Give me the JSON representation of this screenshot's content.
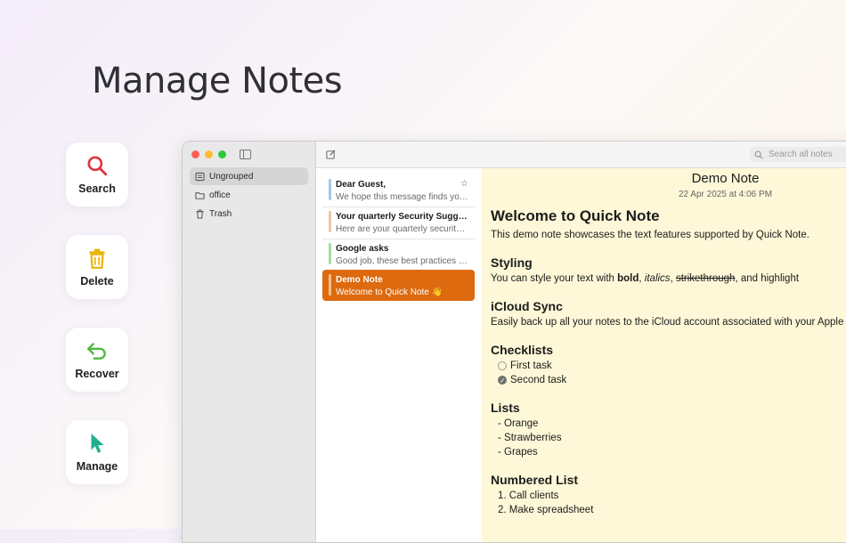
{
  "headline": "Manage Notes",
  "features": [
    {
      "label": "Search",
      "icon": "search-icon",
      "color": "#e0343a"
    },
    {
      "label": "Delete",
      "icon": "trash-icon",
      "color": "#e8b400"
    },
    {
      "label": "Recover",
      "icon": "undo-arrow-icon",
      "color": "#4fb83a"
    },
    {
      "label": "Manage",
      "icon": "pointer-icon",
      "color": "#1fb08e"
    }
  ],
  "sidebar": {
    "items": [
      {
        "label": "Ungrouped",
        "icon": "notes-list-icon",
        "selected": true
      },
      {
        "label": "office",
        "icon": "folder-icon"
      },
      {
        "label": "Trash",
        "icon": "trash-icon"
      }
    ]
  },
  "toolbar": {
    "search_placeholder": "Search all notes"
  },
  "notes": [
    {
      "title": "Dear Guest,",
      "preview": "We hope this message finds you well.",
      "color": "#a8c6e6",
      "starred": true
    },
    {
      "title": "Your quarterly Security Suggestions",
      "preview": "Here are your quarterly security tips",
      "color": "#e9c9a4"
    },
    {
      "title": "Google asks",
      "preview": "Good job, these best practices help",
      "color": "#a6dca0"
    },
    {
      "title": "Demo Note",
      "preview": "Welcome to Quick Note 👋",
      "color": "#f6c08a",
      "selected": true
    }
  ],
  "editor": {
    "title": "Demo Note",
    "date": "22 Apr 2025 at 4:06 PM",
    "heading": "Welcome to Quick Note",
    "intro": "This demo note showcases the text features supported by Quick Note.",
    "styling_heading": "Styling",
    "styling_prefix": "You can style your text with ",
    "styling_bold": "bold",
    "styling_comma1": ", ",
    "styling_italic": "italics",
    "styling_comma2": ", ",
    "styling_strike": "strikethrough",
    "styling_suffix": ", and highlight",
    "icloud_heading": "iCloud Sync",
    "icloud_text": "Easily back up all your notes to the iCloud account associated with your Apple ID",
    "checklists_heading": "Checklists",
    "checklist": [
      {
        "label": "First task",
        "done": false
      },
      {
        "label": "Second task",
        "done": true
      }
    ],
    "lists_heading": "Lists",
    "list": [
      "- Orange",
      "- Strawberries",
      "- Grapes"
    ],
    "numbered_heading": "Numbered List",
    "numbered": [
      "1. Call clients",
      "2. Make spreadsheet"
    ]
  },
  "colors": {
    "accent": "#dd6a0f",
    "editor_bg": "#fef8d8"
  }
}
